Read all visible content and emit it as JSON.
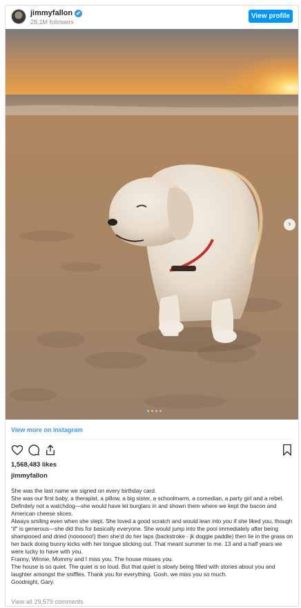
{
  "header": {
    "username": "jimmyfallon",
    "verified_mark": "✔",
    "followers": "28.1M followers",
    "view_profile_label": "View profile"
  },
  "media": {
    "description_icon": "dog-on-beach-photo",
    "carousel_dots": 5,
    "active_dot": 0,
    "next_arrow": "›"
  },
  "view_more_label": "View more on Instagram",
  "icons": [
    "heart-icon",
    "comment-icon",
    "share-icon",
    "bookmark-icon"
  ],
  "likes": "1,568,483 likes",
  "author": "jimmyfallon",
  "caption": [
    "She was the last name we signed on every birthday card.",
    "She was our first baby, a therapist, a pillow, a big sister, a schoolmarm, a comedian, a party girl and a rebel. Definitely not a watchdog—she would have let burglars in and shown them where we kept the bacon and American cheese slices.",
    "Always smiling even when she slept. She loved a good scratch and would lean into you if she liked you, though “if” is generous—she did this for basically everyone. She would jump into the pool immediately after being shampooed and dried (noooooo!) then she’d do her laps (backstroke - jk doggie paddle) then lie in the grass on her back doing bunny kicks with her tongue sticking out. That meant summer to me. 13 and a half years we were lucky to have with you.",
    "Franny, Winnie, Mommy and I miss you. The house misses you.",
    "The house is so quiet. The quiet is so loud. But that quiet is slowly being filled with stories about you and laughter amongst the sniffles. Thank you for everything. Gosh, we miss you so much.",
    "Goodnight, Gary."
  ],
  "comments_label": "View all 29,579 comments"
}
